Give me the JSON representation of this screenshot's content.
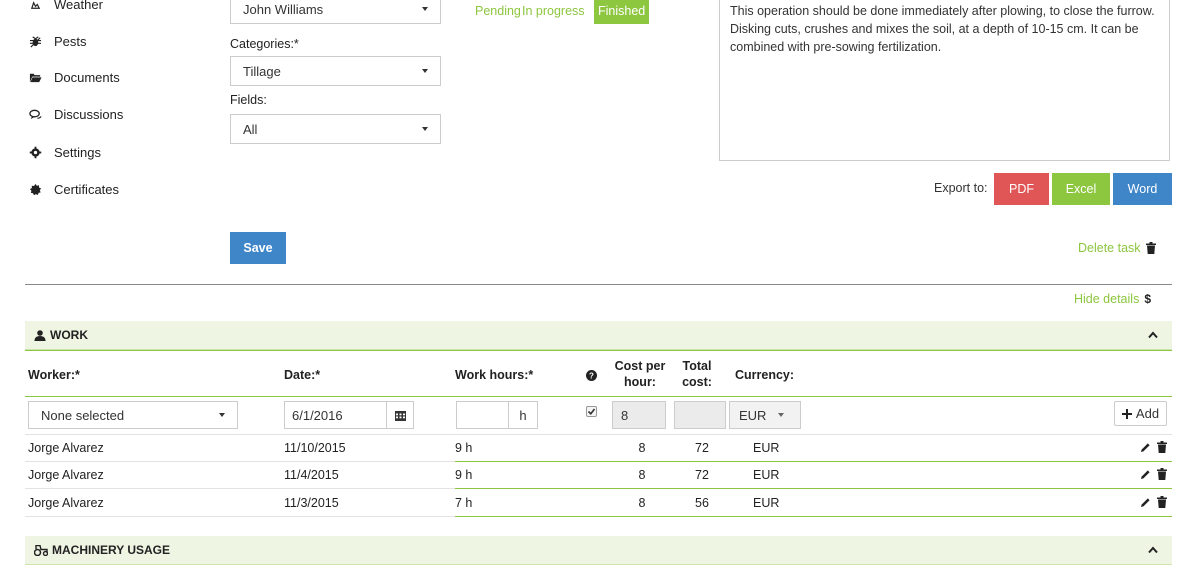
{
  "sidebar": {
    "items": [
      {
        "label": "Weather",
        "icon": "weather-icon"
      },
      {
        "label": "Pests",
        "icon": "bug-icon"
      },
      {
        "label": "Documents",
        "icon": "folder-icon"
      },
      {
        "label": "Discussions",
        "icon": "comments-icon"
      },
      {
        "label": "Settings",
        "icon": "gear-icon"
      },
      {
        "label": "Certificates",
        "icon": "certificate-icon"
      }
    ]
  },
  "form": {
    "responsible_value": "John Williams",
    "categories_label": "Categories:*",
    "categories_value": "Tillage",
    "fields_label": "Fields:",
    "fields_value": "All",
    "save_label": "Save"
  },
  "status": {
    "options": [
      "Pending",
      "In progress",
      "Finished"
    ],
    "selected": "Finished"
  },
  "description": "This operation should be done immediately after plowing, to close the furrow. Disking cuts, crushes and mixes the soil, at a depth of 10-15 cm. It can be combined with pre-sowing fertilization.",
  "export": {
    "label": "Export to:",
    "pdf": "PDF",
    "excel": "Excel",
    "word": "Word"
  },
  "actions": {
    "delete_task": "Delete task",
    "hide_details": "Hide details"
  },
  "work": {
    "title": "WORK",
    "headers": {
      "worker": "Worker:*",
      "date": "Date:*",
      "hours": "Work hours:*",
      "cost_per_hour": "Cost per hour:",
      "total_cost": "Total cost:",
      "currency": "Currency:"
    },
    "new_entry": {
      "worker": "None selected",
      "date": "6/1/2016",
      "hours": "",
      "hours_unit": "h",
      "cost_per_hour": "8",
      "total_cost": "",
      "currency": "EUR",
      "add_label": "Add"
    },
    "rows": [
      {
        "worker": "Jorge Alvarez",
        "date": "11/10/2015",
        "hours": "9 h",
        "cost": "8",
        "total": "72",
        "currency": "EUR"
      },
      {
        "worker": "Jorge Alvarez",
        "date": "11/4/2015",
        "hours": "9 h",
        "cost": "8",
        "total": "72",
        "currency": "EUR"
      },
      {
        "worker": "Jorge Alvarez",
        "date": "11/3/2015",
        "hours": "7 h",
        "cost": "8",
        "total": "56",
        "currency": "EUR"
      }
    ]
  },
  "machinery": {
    "title": "MACHINERY USAGE"
  },
  "colors": {
    "green": "#8dc63f",
    "pdf": "#e05656",
    "word": "#3f86c9",
    "save": "#3f86c9"
  }
}
